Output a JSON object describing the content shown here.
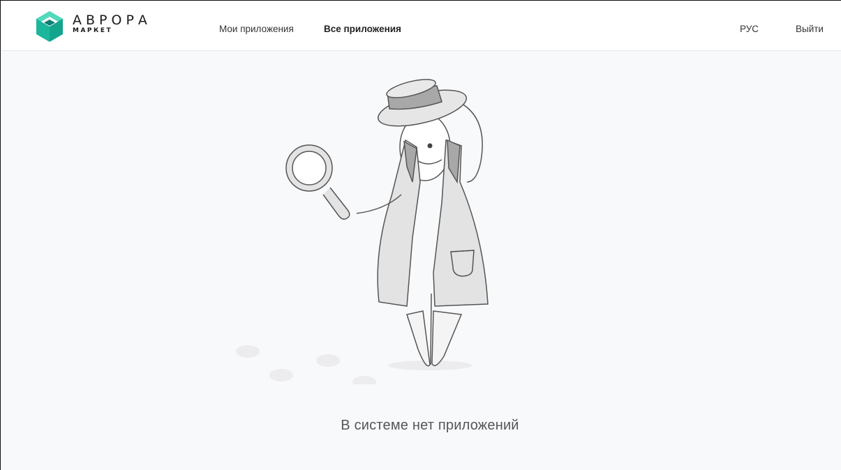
{
  "header": {
    "logo": {
      "title": "АВРОРА",
      "subtitle": "МАРКЕТ",
      "icon": "aurora-cube-icon",
      "colors": [
        "#2fc4a7",
        "#0f7e74",
        "#54d6b7"
      ]
    },
    "nav": {
      "my_apps": "Мои приложения",
      "all_apps": "Все приложения"
    },
    "language": "РУС",
    "logout": "Выйти"
  },
  "main": {
    "illustration": "detective-magnifier-illustration",
    "empty_message": "В системе нет приложений"
  }
}
